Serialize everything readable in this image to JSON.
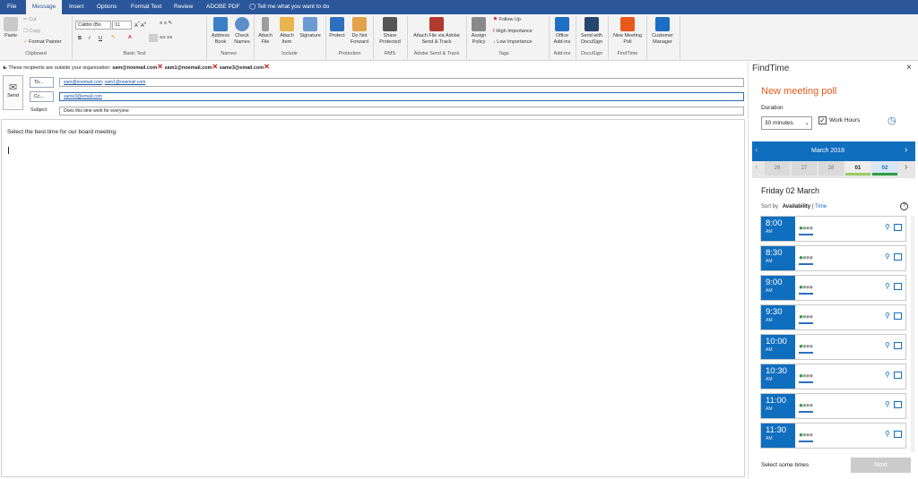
{
  "tabs": [
    "File",
    "Message",
    "Insert",
    "Options",
    "Format Text",
    "Review",
    "ADOBE PDF"
  ],
  "tell_me": "Tell me what you want to do",
  "ribbon": {
    "clipboard": {
      "paste": "Paste",
      "cut": "Cut",
      "copy": "Copy",
      "format_painter": "Format Painter",
      "label": "Clipboard"
    },
    "basic_text": {
      "font": "Calibri (Bo",
      "size": "11",
      "label": "Basic Text"
    },
    "names": {
      "address_book": "Address Book",
      "check_names": "Check Names",
      "label": "Names"
    },
    "include": {
      "attach_file": "Attach File",
      "attach_item": "Attach Item",
      "signature": "Signature",
      "label": "Include"
    },
    "protection": {
      "protect": "Protect",
      "do_not_forward": "Do Not Forward",
      "label": "Protection"
    },
    "rms": {
      "share_protected": "Share Protected",
      "label": "RMS"
    },
    "adobe": {
      "attach_via": "Attach File via Adobe Send & Track",
      "label": "Adobe Send & Track"
    },
    "tags": {
      "assign_policy": "Assign Policy",
      "follow_up": "Follow Up",
      "high": "High Importance",
      "low": "Low Importance",
      "label": "Tags"
    },
    "addins": {
      "office_addins": "Office Add-ins",
      "label": "Add-ins"
    },
    "docusign": {
      "send": "Send with DocuSign",
      "label": "DocuSign"
    },
    "findtime": {
      "new_poll": "New Meeting Poll",
      "label": "FindTime"
    },
    "customer": {
      "manager": "Customer Manager"
    }
  },
  "infobar": {
    "text": "These recipients are outside your organization:",
    "recipients": [
      "sam@noemail.com",
      "sam1@noemail.com",
      "same3@email.com"
    ]
  },
  "compose": {
    "send": "Send",
    "to_label": "To...",
    "cc_label": "Cc...",
    "subject_label": "Subject",
    "to_values": [
      "sam@noemail.com",
      "sam1@noemail.com"
    ],
    "cc_value": "same3@email.com",
    "subject": "Does this time work for everyone",
    "body": "Select the best time for our board meeting."
  },
  "findtime": {
    "title": "FindTime",
    "heading": "New meeting poll",
    "duration_label": "Duration",
    "duration_value": "30 minutes",
    "work_hours": "Work Hours",
    "month": "March 2018",
    "days": [
      "26",
      "27",
      "28",
      "01",
      "02"
    ],
    "selected_day": "02",
    "date_heading": "Friday 02 March",
    "sort_by": "Sort by",
    "sort_availability": "Availability",
    "sort_time": "Time",
    "slots": [
      {
        "time": "8:00",
        "ampm": "AM"
      },
      {
        "time": "8:30",
        "ampm": "AM"
      },
      {
        "time": "9:00",
        "ampm": "AM"
      },
      {
        "time": "9:30",
        "ampm": "AM"
      },
      {
        "time": "10:00",
        "ampm": "AM"
      },
      {
        "time": "10:30",
        "ampm": "AM"
      },
      {
        "time": "11:00",
        "ampm": "AM"
      },
      {
        "time": "11:30",
        "ampm": "AM"
      }
    ],
    "footer_text": "Select some times",
    "next": "Next"
  },
  "colors": {
    "accent": "#2b579a",
    "slot_blue": "#106ebe",
    "heading_orange": "#e8591a"
  }
}
